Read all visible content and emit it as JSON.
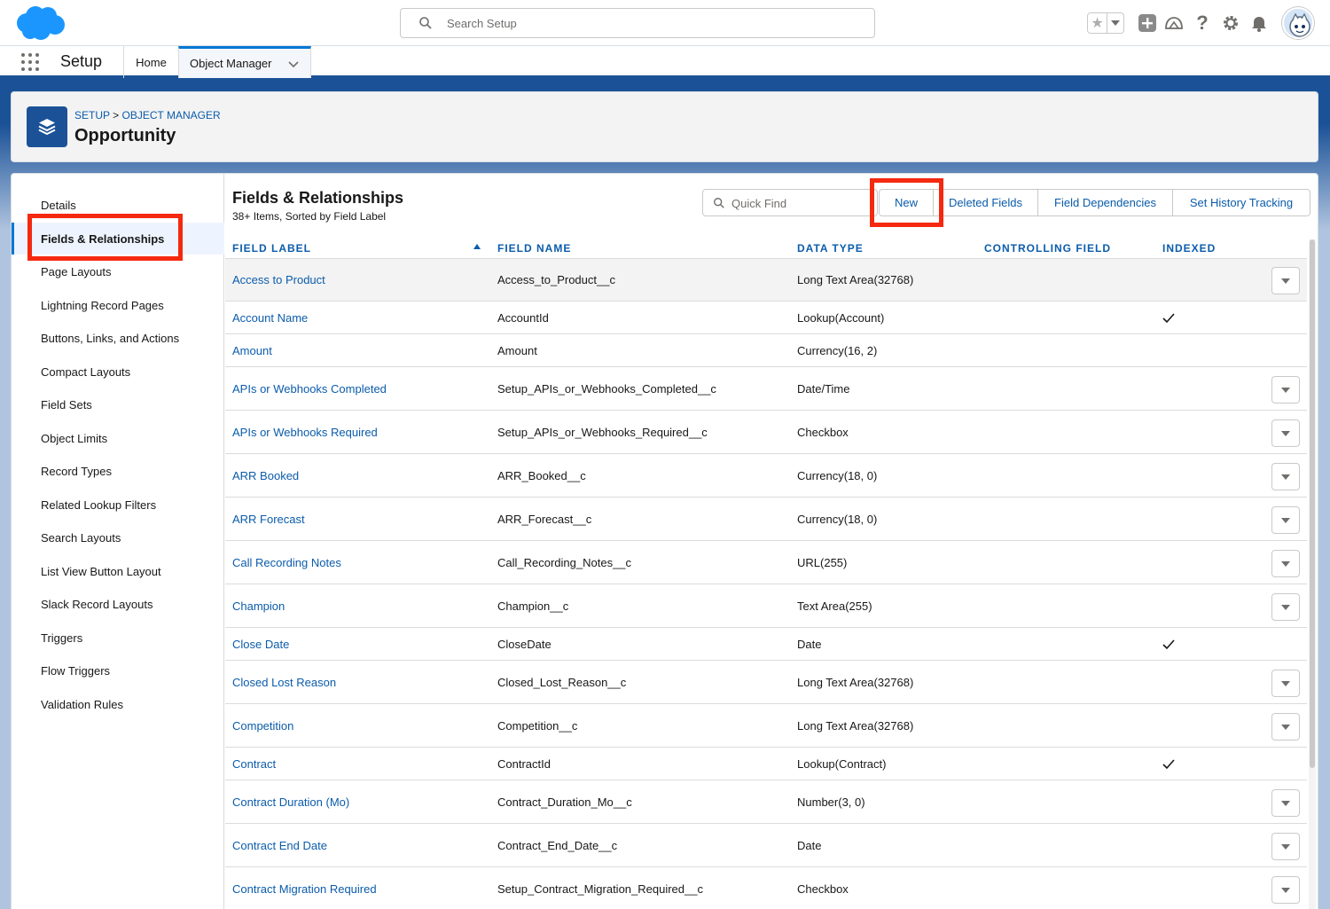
{
  "header": {
    "search_placeholder": "Search Setup",
    "icons": [
      "favorites-star-icon",
      "add-icon",
      "trailhead-icon",
      "help-icon",
      "gear-icon",
      "bell-icon",
      "user-avatar"
    ]
  },
  "context_bar": {
    "app_name": "Setup",
    "tabs": [
      {
        "label": "Home"
      },
      {
        "label": "Object Manager"
      }
    ]
  },
  "page_header": {
    "breadcrumb": {
      "setup": "SETUP",
      "separator": ">",
      "object_manager": "OBJECT MANAGER"
    },
    "title": "Opportunity"
  },
  "sidebar": {
    "items": [
      {
        "label": "Details"
      },
      {
        "label": "Fields & Relationships"
      },
      {
        "label": "Page Layouts"
      },
      {
        "label": "Lightning Record Pages"
      },
      {
        "label": "Buttons, Links, and Actions"
      },
      {
        "label": "Compact Layouts"
      },
      {
        "label": "Field Sets"
      },
      {
        "label": "Object Limits"
      },
      {
        "label": "Record Types"
      },
      {
        "label": "Related Lookup Filters"
      },
      {
        "label": "Search Layouts"
      },
      {
        "label": "List View Button Layout"
      },
      {
        "label": "Slack Record Layouts"
      },
      {
        "label": "Triggers"
      },
      {
        "label": "Flow Triggers"
      },
      {
        "label": "Validation Rules"
      }
    ],
    "active": "Fields & Relationships"
  },
  "content": {
    "title": "Fields & Relationships",
    "subtitle": "38+ Items, Sorted by Field Label",
    "quick_find_placeholder": "Quick Find",
    "buttons": {
      "new": "New",
      "deleted_fields": "Deleted Fields",
      "field_dependencies": "Field Dependencies",
      "set_history_tracking": "Set History Tracking"
    },
    "columns": {
      "field_label": "FIELD LABEL",
      "field_name": "FIELD NAME",
      "data_type": "DATA TYPE",
      "controlling_field": "CONTROLLING FIELD",
      "indexed": "INDEXED"
    },
    "rows": [
      {
        "label": "Access to Product",
        "name": "Access_to_Product__c",
        "type": "Long Text Area(32768)",
        "indexed": false,
        "menu": true
      },
      {
        "label": "Account Name",
        "name": "AccountId",
        "type": "Lookup(Account)",
        "indexed": true,
        "menu": false
      },
      {
        "label": "Amount",
        "name": "Amount",
        "type": "Currency(16, 2)",
        "indexed": false,
        "menu": false
      },
      {
        "label": "APIs or Webhooks Completed",
        "name": "Setup_APIs_or_Webhooks_Completed__c",
        "type": "Date/Time",
        "indexed": false,
        "menu": true
      },
      {
        "label": "APIs or Webhooks Required",
        "name": "Setup_APIs_or_Webhooks_Required__c",
        "type": "Checkbox",
        "indexed": false,
        "menu": true
      },
      {
        "label": "ARR Booked",
        "name": "ARR_Booked__c",
        "type": "Currency(18, 0)",
        "indexed": false,
        "menu": true
      },
      {
        "label": "ARR Forecast",
        "name": "ARR_Forecast__c",
        "type": "Currency(18, 0)",
        "indexed": false,
        "menu": true
      },
      {
        "label": "Call Recording Notes",
        "name": "Call_Recording_Notes__c",
        "type": "URL(255)",
        "indexed": false,
        "menu": true
      },
      {
        "label": "Champion",
        "name": "Champion__c",
        "type": "Text Area(255)",
        "indexed": false,
        "menu": true
      },
      {
        "label": "Close Date",
        "name": "CloseDate",
        "type": "Date",
        "indexed": true,
        "menu": false
      },
      {
        "label": "Closed Lost Reason",
        "name": "Closed_Lost_Reason__c",
        "type": "Long Text Area(32768)",
        "indexed": false,
        "menu": true
      },
      {
        "label": "Competition",
        "name": "Competition__c",
        "type": "Long Text Area(32768)",
        "indexed": false,
        "menu": true
      },
      {
        "label": "Contract",
        "name": "ContractId",
        "type": "Lookup(Contract)",
        "indexed": true,
        "menu": false
      },
      {
        "label": "Contract Duration (Mo)",
        "name": "Contract_Duration_Mo__c",
        "type": "Number(3, 0)",
        "indexed": false,
        "menu": true
      },
      {
        "label": "Contract End Date",
        "name": "Contract_End_Date__c",
        "type": "Date",
        "indexed": false,
        "menu": true
      },
      {
        "label": "Contract Migration Required",
        "name": "Setup_Contract_Migration_Required__c",
        "type": "Checkbox",
        "indexed": false,
        "menu": true
      }
    ]
  },
  "colors": {
    "brand_blue": "#0176d3",
    "link_blue": "#0b5cab",
    "highlight_red": "#f4290f",
    "cloud_blue": "#1b96ff"
  }
}
